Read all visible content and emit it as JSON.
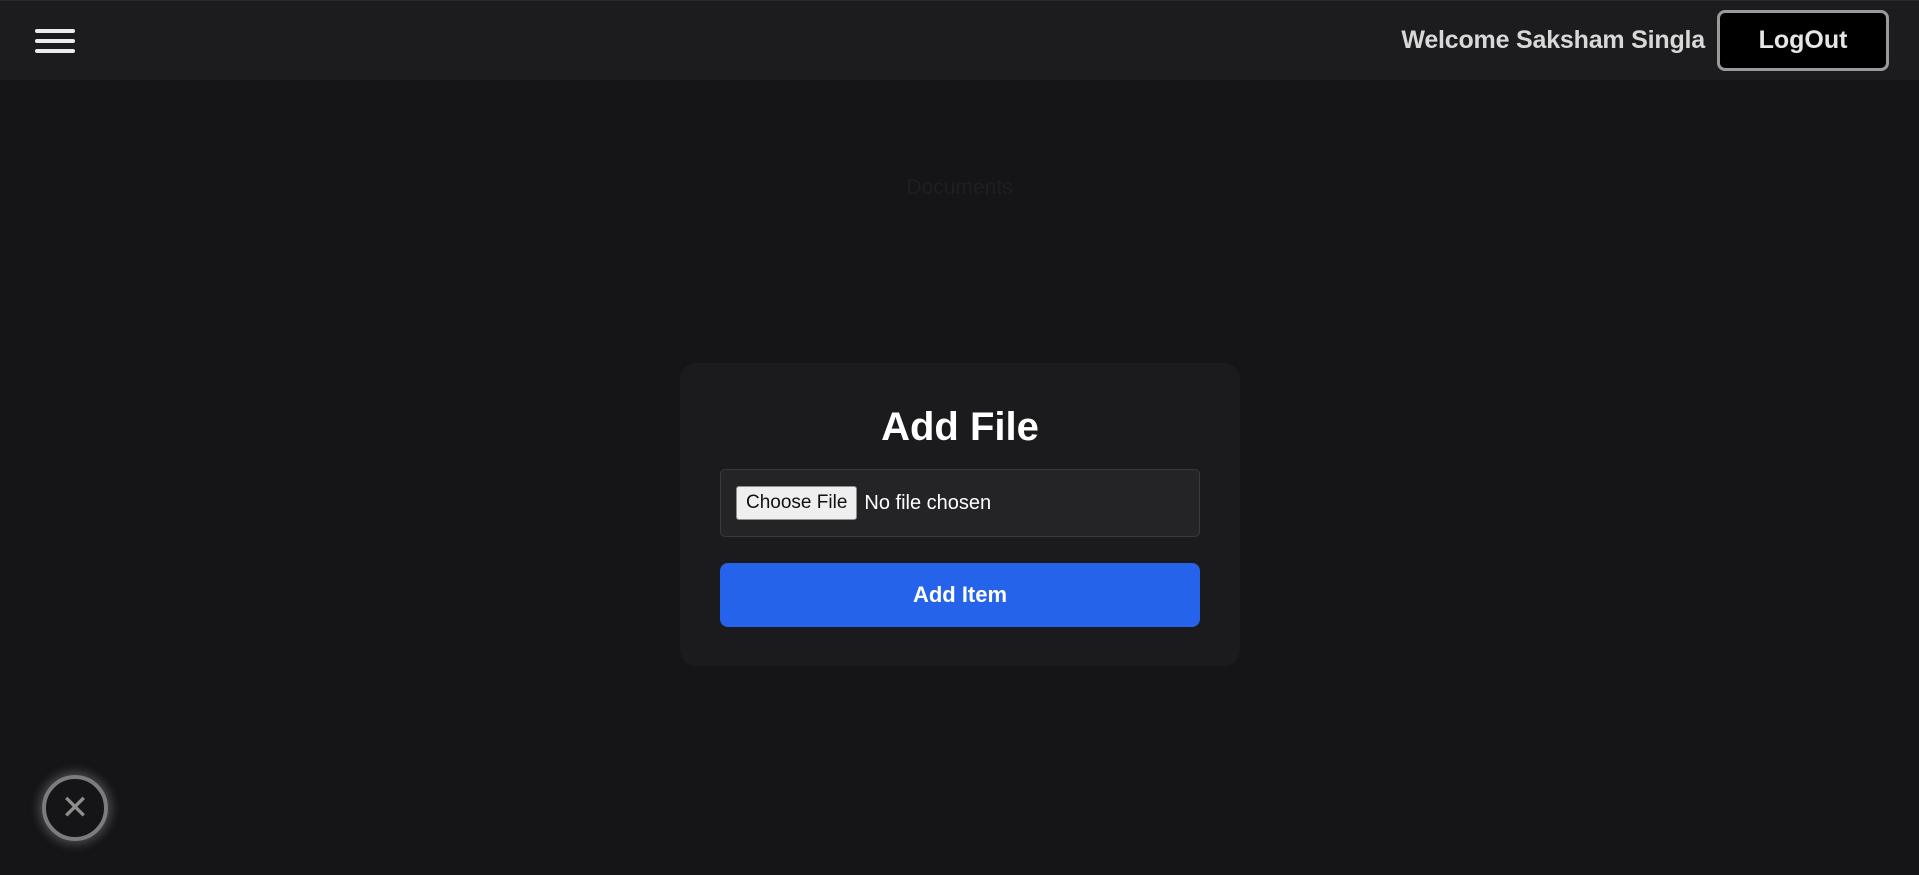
{
  "header": {
    "welcome_text": "Welcome Saksham Singla",
    "logout_label": "LogOut",
    "menu_icon": "hamburger-menu-icon"
  },
  "background": {
    "label": "Documents"
  },
  "dialog": {
    "title": "Add File",
    "file_button_label": "Choose File",
    "file_status": "No file chosen",
    "submit_label": "Add Item"
  },
  "fab": {
    "icon": "close-icon",
    "glyph": "✕"
  },
  "colors": {
    "background": "#151517",
    "topbar": "#1c1c1f",
    "card": "#1b1b1e",
    "accent": "#2563eb"
  }
}
